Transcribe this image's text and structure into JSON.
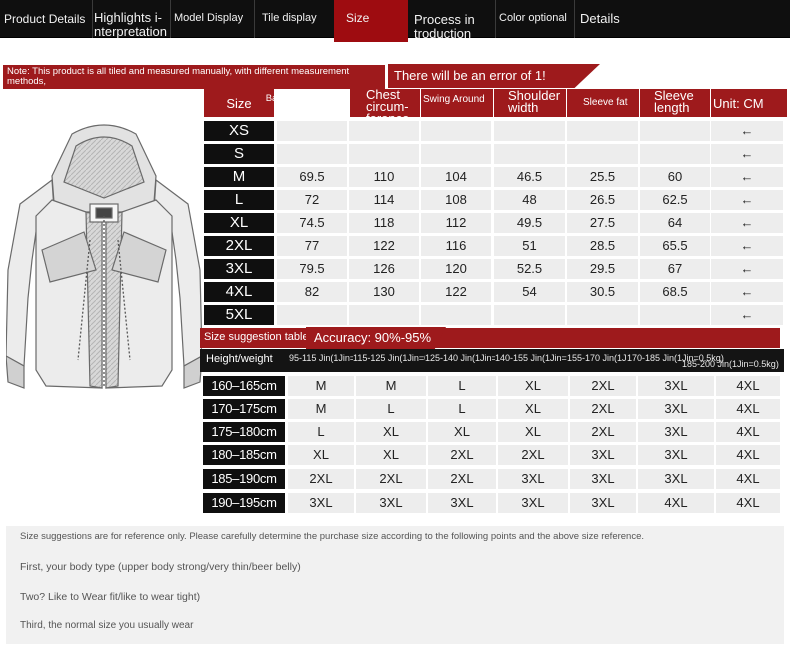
{
  "nav": [
    {
      "label": "Product Details",
      "active": false
    },
    {
      "label": "Highlights i-nterpretation",
      "active": false
    },
    {
      "label": "Model Display",
      "active": false
    },
    {
      "label": "Tile display",
      "active": false
    },
    {
      "label": "Size",
      "active": true
    },
    {
      "label": "Process in troduction",
      "active": false
    },
    {
      "label": "Color optional",
      "active": false
    },
    {
      "label": "Details",
      "active": false
    }
  ],
  "note": {
    "text": "Note: This product is all tiled and measured manually, with different measurement methods,",
    "error": "There will be an error of 1!"
  },
  "size_table": {
    "headers": [
      "Size",
      "Back middle length",
      "Chest circum-ference",
      "Swing Around",
      "Shoulder width",
      "Sleeve fat",
      "Sleeve length",
      "Unit: CM"
    ],
    "rows": [
      {
        "size": "XS",
        "values": [
          "",
          "",
          "",
          "",
          "",
          ""
        ],
        "arrow": "←"
      },
      {
        "size": "S",
        "values": [
          "",
          "",
          "",
          "",
          "",
          ""
        ],
        "arrow": "←"
      },
      {
        "size": "M",
        "values": [
          "69.5",
          "110",
          "104",
          "46.5",
          "25.5",
          "60"
        ],
        "arrow": "←"
      },
      {
        "size": "L",
        "values": [
          "72",
          "114",
          "108",
          "48",
          "26.5",
          "62.5"
        ],
        "arrow": "←"
      },
      {
        "size": "XL",
        "values": [
          "74.5",
          "118",
          "112",
          "49.5",
          "27.5",
          "64"
        ],
        "arrow": "←"
      },
      {
        "size": "2XL",
        "values": [
          "77",
          "122",
          "116",
          "51",
          "28.5",
          "65.5"
        ],
        "arrow": "←"
      },
      {
        "size": "3XL",
        "values": [
          "79.5",
          "126",
          "120",
          "52.5",
          "29.5",
          "67"
        ],
        "arrow": "←"
      },
      {
        "size": "4XL",
        "values": [
          "82",
          "130",
          "122",
          "54",
          "30.5",
          "68.5"
        ],
        "arrow": "←"
      },
      {
        "size": "5XL",
        "values": [
          "",
          "",
          "",
          "",
          "",
          ""
        ],
        "arrow": "←"
      }
    ]
  },
  "suggestion": {
    "title": "Size suggestion table",
    "accuracy": "Accuracy: 90%-95%",
    "row_header": "Height/weight",
    "weights": [
      "95-115 Jin(1Jin=0.5kg)",
      "115-125 Jin(1Jin=0.5kg)",
      "125-140 Jin(1Jin=0.5kg)",
      "140-155 Jin(1Jin=0.5kg)",
      "155-170 Jin(1Jin=0.5kg)",
      "170-185 Jin(1Jin=0.5kg)",
      "185-200 Jin(1Jin=0.5kg)"
    ],
    "rows": [
      {
        "height": "160–165cm",
        "sizes": [
          "M",
          "M",
          "L",
          "XL",
          "2XL",
          "3XL",
          "4XL"
        ]
      },
      {
        "height": "170–175cm",
        "sizes": [
          "M",
          "L",
          "L",
          "XL",
          "2XL",
          "3XL",
          "4XL"
        ]
      },
      {
        "height": "175–180cm",
        "sizes": [
          "L",
          "XL",
          "XL",
          "XL",
          "2XL",
          "3XL",
          "4XL"
        ]
      },
      {
        "height": "180–185cm",
        "sizes": [
          "XL",
          "XL",
          "2XL",
          "2XL",
          "3XL",
          "3XL",
          "4XL"
        ]
      },
      {
        "height": "185–190cm",
        "sizes": [
          "2XL",
          "2XL",
          "2XL",
          "3XL",
          "3XL",
          "3XL",
          "4XL"
        ]
      },
      {
        "height": "190–195cm",
        "sizes": [
          "3XL",
          "3XL",
          "3XL",
          "3XL",
          "3XL",
          "4XL",
          "4XL"
        ]
      }
    ]
  },
  "bottom_notes": [
    "Size suggestions are for reference only. Please carefully determine the purchase size according to the following points and the above size reference.",
    "First, your body type (upper body strong/very thin/beer belly)",
    "Two? Like to Wear fit/like to wear tight)",
    "Third, the normal size you usually wear"
  ],
  "colors": {
    "accent": "#9e1a1c",
    "nav_bg": "#0f0f0f",
    "cell_bg": "#ededed"
  }
}
